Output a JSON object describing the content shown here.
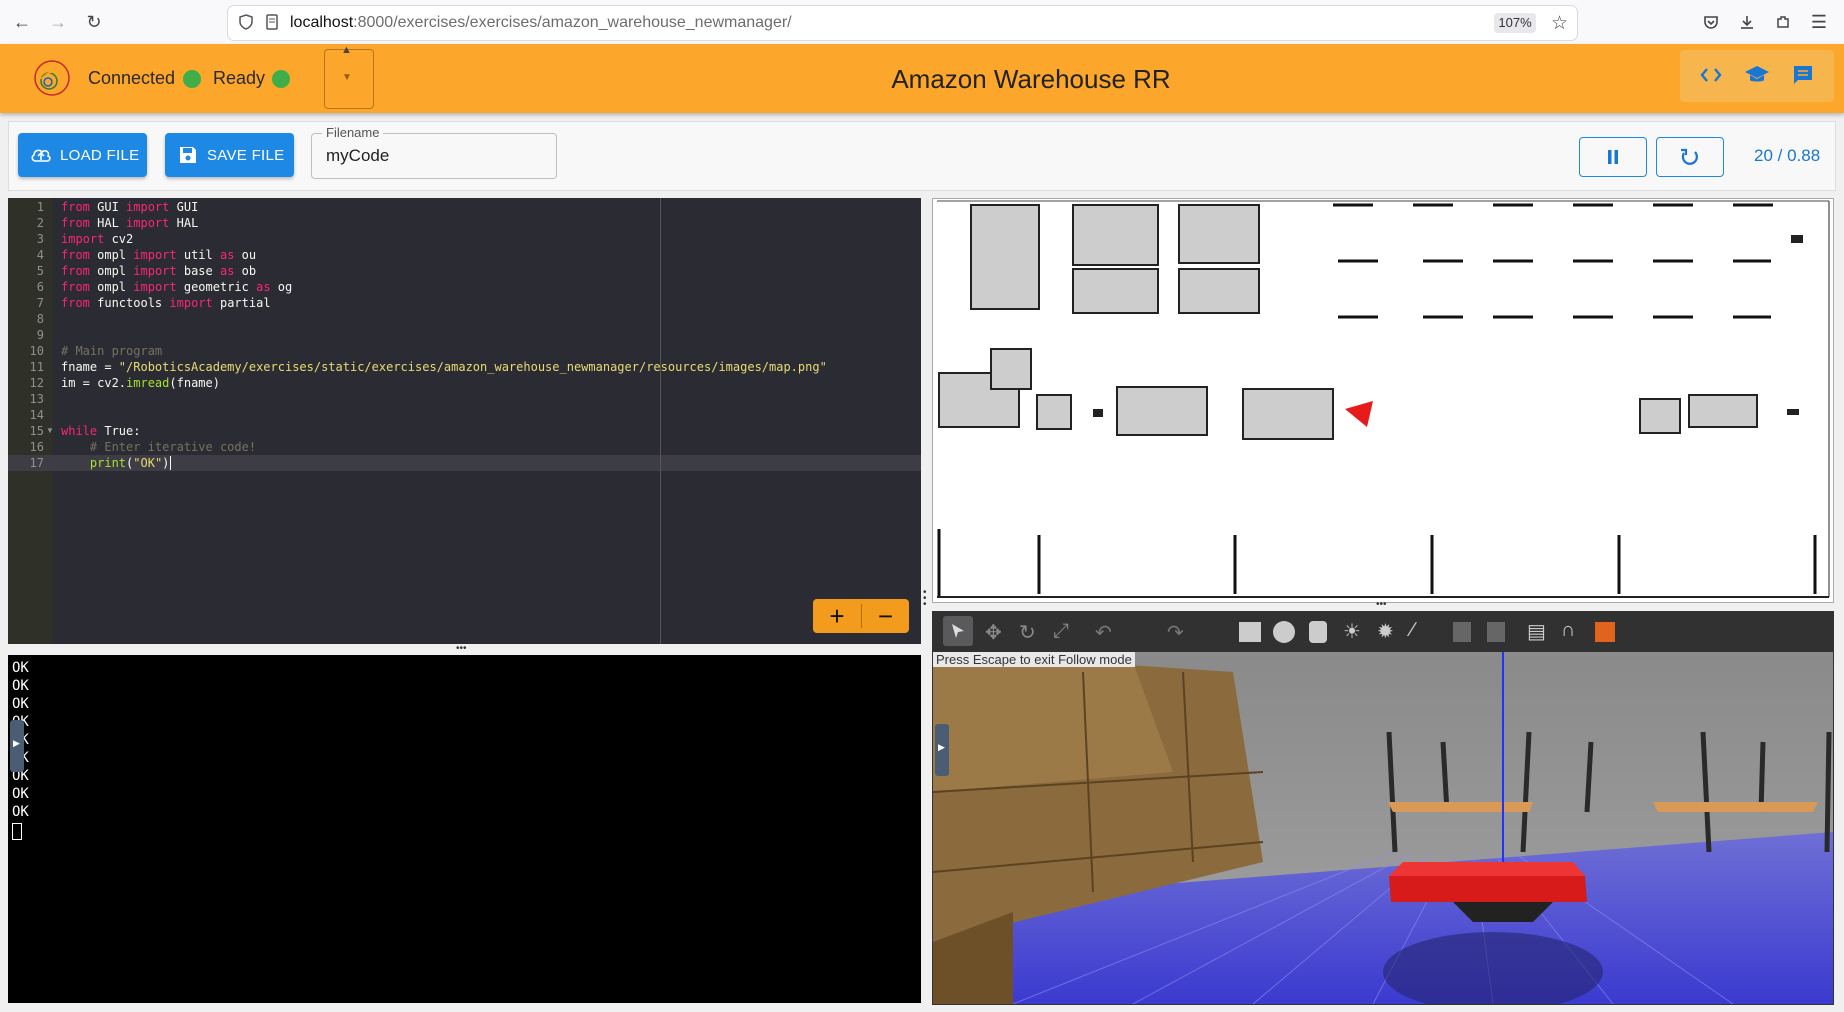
{
  "browser": {
    "url_host": "localhost",
    "url_path": ":8000/exercises/exercises/amazon_warehouse_newmanager/",
    "zoom": "107%"
  },
  "header": {
    "connected_label": "Connected",
    "ready_label": "Ready",
    "title": "Amazon Warehouse RR",
    "status_color": "#3fae48",
    "accent_color": "#fca72b"
  },
  "toolbar": {
    "load_label": "LOAD FILE",
    "save_label": "SAVE FILE",
    "filename_label": "Filename",
    "filename_value": "myCode",
    "time": "20 / 0.88"
  },
  "editor": {
    "line_numbers": [
      "1",
      "2",
      "3",
      "4",
      "5",
      "6",
      "7",
      "8",
      "9",
      "10",
      "11",
      "12",
      "13",
      "14",
      "15",
      "16",
      "17"
    ],
    "lines": [
      [
        [
          "kw",
          "from"
        ],
        [
          "t",
          " GUI "
        ],
        [
          "kw",
          "import"
        ],
        [
          "t",
          " GUI"
        ]
      ],
      [
        [
          "kw",
          "from"
        ],
        [
          "t",
          " HAL "
        ],
        [
          "kw",
          "import"
        ],
        [
          "t",
          " HAL"
        ]
      ],
      [
        [
          "kw",
          "import"
        ],
        [
          "t",
          " cv2"
        ]
      ],
      [
        [
          "kw",
          "from"
        ],
        [
          "t",
          " ompl "
        ],
        [
          "kw",
          "import"
        ],
        [
          "t",
          " util "
        ],
        [
          "kw",
          "as"
        ],
        [
          "t",
          " ou"
        ]
      ],
      [
        [
          "kw",
          "from"
        ],
        [
          "t",
          " ompl "
        ],
        [
          "kw",
          "import"
        ],
        [
          "t",
          " base "
        ],
        [
          "kw",
          "as"
        ],
        [
          "t",
          " ob"
        ]
      ],
      [
        [
          "kw",
          "from"
        ],
        [
          "t",
          " ompl "
        ],
        [
          "kw",
          "import"
        ],
        [
          "t",
          " geometric "
        ],
        [
          "kw",
          "as"
        ],
        [
          "t",
          " og"
        ]
      ],
      [
        [
          "kw",
          "from"
        ],
        [
          "t",
          " functools "
        ],
        [
          "kw",
          "import"
        ],
        [
          "t",
          " partial"
        ]
      ],
      [],
      [],
      [
        [
          "cm",
          "# Main program"
        ]
      ],
      [
        [
          "t",
          "fname = "
        ],
        [
          "str",
          "\"/RoboticsAcademy/exercises/static/exercises/amazon_warehouse_newmanager/resources/images/map.png\""
        ]
      ],
      [
        [
          "t",
          "im = cv2."
        ],
        [
          "fn",
          "imread"
        ],
        [
          "t",
          "(fname)"
        ]
      ],
      [],
      [],
      [
        [
          "kw",
          "while"
        ],
        [
          "t",
          " True:"
        ]
      ],
      [
        [
          "t",
          "    "
        ],
        [
          "cm",
          "# Enter iterative code!"
        ]
      ],
      [
        [
          "t",
          "    "
        ],
        [
          "fn",
          "print"
        ],
        [
          "t",
          "("
        ],
        [
          "str",
          "\"OK\""
        ],
        [
          "t",
          ")"
        ]
      ]
    ],
    "zoom_in": "+",
    "zoom_out": "−"
  },
  "console": {
    "lines": [
      "OK",
      "OK",
      "OK",
      "OK",
      "OK",
      "OK",
      "OK",
      "OK",
      "OK"
    ]
  },
  "view3d": {
    "escape_message": "Press Escape to exit Follow mode"
  }
}
